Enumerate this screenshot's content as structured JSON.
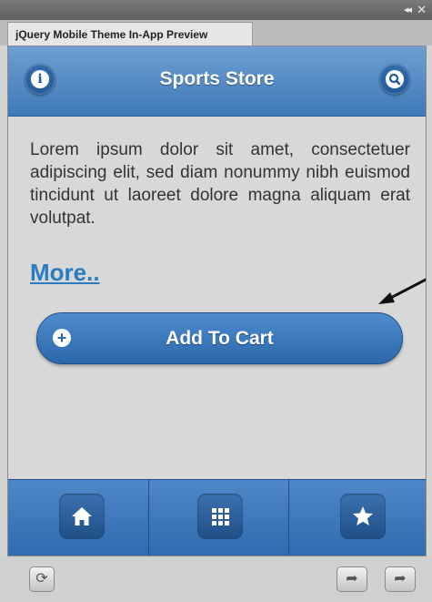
{
  "window": {
    "tab_title": "jQuery Mobile Theme In-App Preview",
    "collapse_glyph": "◂◂",
    "close_glyph": "✕"
  },
  "header": {
    "title": "Sports Store",
    "left_icon": "info-icon",
    "right_icon": "search-icon",
    "info_glyph": "i",
    "search_glyph": "🔍"
  },
  "content": {
    "paragraph": "Lorem ipsum dolor sit amet, consectetuer adipiscing elit, sed diam nonummy nibh euismod tincidunt ut laoreet dolore magna aliquam erat volutpat.",
    "more_link": "More..",
    "add_to_cart": "Add To Cart",
    "plus_glyph": "+"
  },
  "navbar": {
    "items": [
      {
        "icon": "home-icon"
      },
      {
        "icon": "grid-icon"
      },
      {
        "icon": "star-icon"
      }
    ]
  },
  "bottom_toolbar": {
    "refresh_glyph": "⟳",
    "export_glyph": "➦",
    "share_glyph": "➦"
  },
  "colors": {
    "header": "#4f86c4",
    "link": "#2b7bc0",
    "button": "#3b7abd"
  }
}
